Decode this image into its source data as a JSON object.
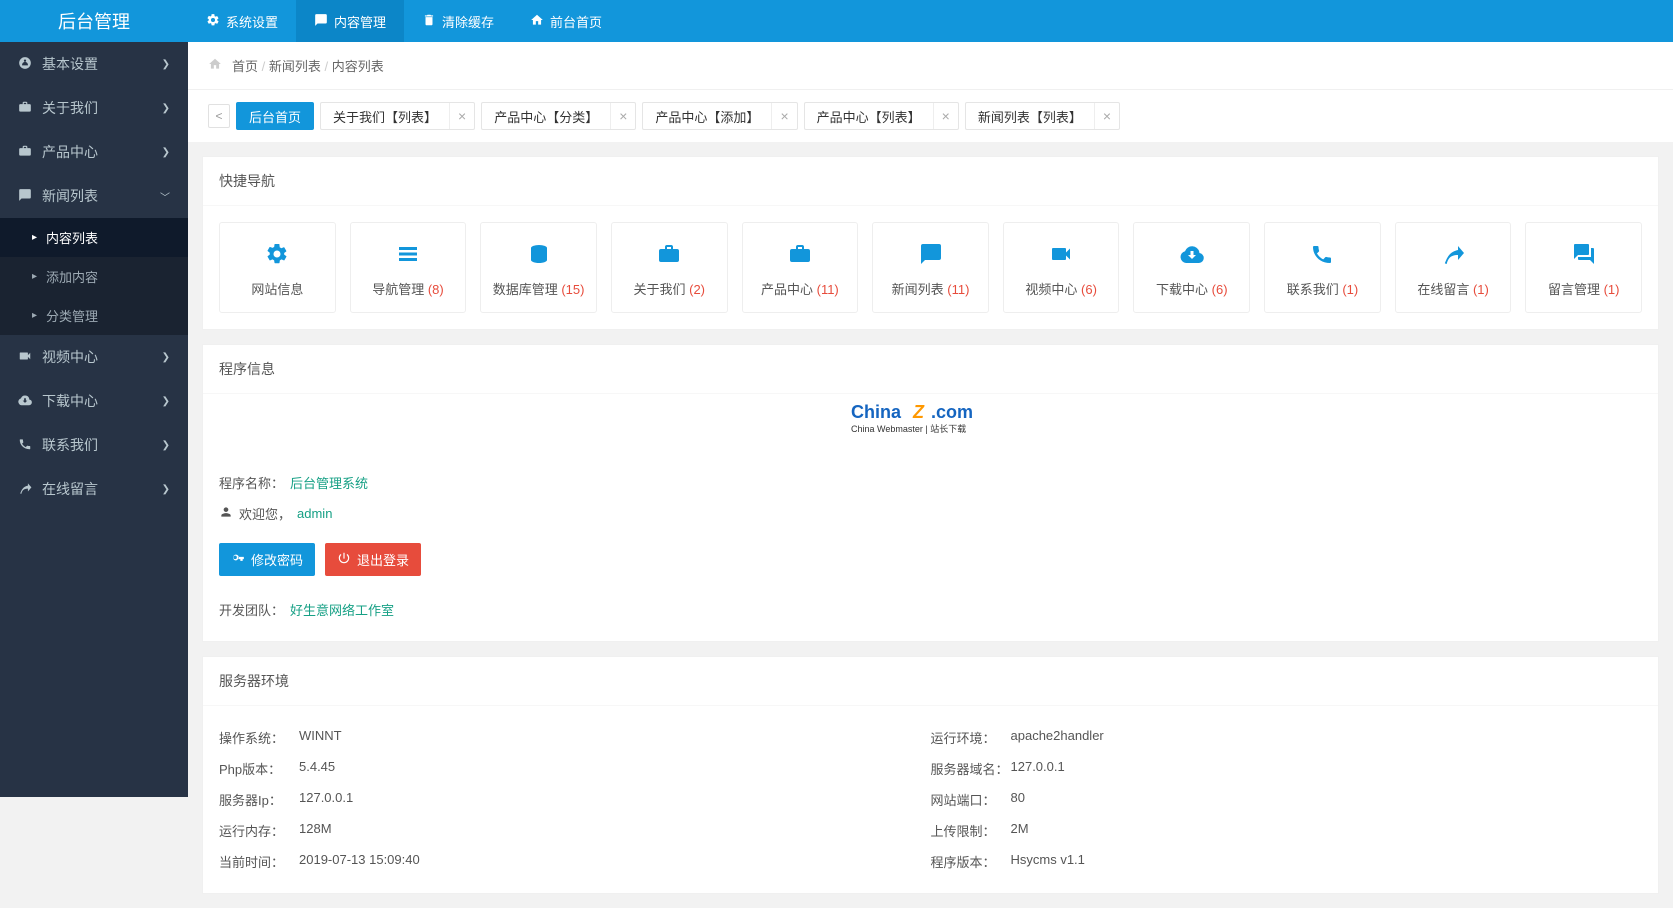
{
  "brand": "后台管理",
  "topnav": [
    {
      "label": "系统设置"
    },
    {
      "label": "内容管理",
      "active": true
    },
    {
      "label": "清除缓存"
    },
    {
      "label": "前台首页"
    }
  ],
  "sidebar": [
    {
      "label": "基本设置",
      "chev": "❯"
    },
    {
      "label": "关于我们",
      "chev": "❯",
      "open": false
    },
    {
      "label": "产品中心",
      "chev": "❯",
      "open": false
    },
    {
      "label": "新闻列表",
      "chev": "❯",
      "open": true,
      "children": [
        {
          "label": "内容列表",
          "active": true
        },
        {
          "label": "添加内容"
        },
        {
          "label": "分类管理"
        }
      ]
    },
    {
      "label": "视频中心",
      "chev": "❯"
    },
    {
      "label": "下载中心",
      "chev": "❯"
    },
    {
      "label": "联系我们",
      "chev": "❯"
    },
    {
      "label": "在线留言",
      "chev": "❯"
    }
  ],
  "breadcrumb": [
    "首页",
    "新闻列表",
    "内容列表"
  ],
  "tabs": [
    {
      "label": "后台首页",
      "active": true,
      "closable": false
    },
    {
      "label": "关于我们【列表】"
    },
    {
      "label": "产品中心【分类】"
    },
    {
      "label": "产品中心【添加】"
    },
    {
      "label": "产品中心【列表】"
    },
    {
      "label": "新闻列表【列表】"
    }
  ],
  "sections": {
    "quicknav_title": "快捷导航",
    "program_title": "程序信息",
    "server_title": "服务器环境"
  },
  "quicknav": [
    {
      "label": "网站信息",
      "count": ""
    },
    {
      "label": "导航管理",
      "count": "(8)"
    },
    {
      "label": "数据库管理",
      "count": "(15)"
    },
    {
      "label": "关于我们",
      "count": "(2)"
    },
    {
      "label": "产品中心",
      "count": "(11)"
    },
    {
      "label": "新闻列表",
      "count": "(11)"
    },
    {
      "label": "视频中心",
      "count": "(6)"
    },
    {
      "label": "下载中心",
      "count": "(6)"
    },
    {
      "label": "联系我们",
      "count": "(1)"
    },
    {
      "label": "在线留言",
      "count": "(1)"
    },
    {
      "label": "留言管理",
      "count": "(1)"
    }
  ],
  "program": {
    "name_label": "程序名称：",
    "name_value": "后台管理系统",
    "welcome_label": "欢迎您，",
    "welcome_user": "admin",
    "btn_pwd": "修改密码",
    "btn_logout": "退出登录",
    "dev_label": "开发团队：",
    "dev_value": "好生意网络工作室"
  },
  "logo": {
    "main": "ChinaZ.com",
    "sub": "China Webmaster | 站长下载"
  },
  "server_left": [
    {
      "k": "操作系统：",
      "v": "WINNT"
    },
    {
      "k": "Php版本：",
      "v": "5.4.45"
    },
    {
      "k": "服务器Ip：",
      "v": "127.0.0.1"
    },
    {
      "k": "运行内存：",
      "v": "128M"
    },
    {
      "k": "当前时间：",
      "v": "2019-07-13 15:09:40"
    }
  ],
  "server_right": [
    {
      "k": "运行环境：",
      "v": "apache2handler"
    },
    {
      "k": "服务器域名：",
      "v": "127.0.0.1"
    },
    {
      "k": "网站端口：",
      "v": "80"
    },
    {
      "k": "上传限制：",
      "v": "2M"
    },
    {
      "k": "程序版本：",
      "v": "Hsycms v1.1"
    }
  ]
}
